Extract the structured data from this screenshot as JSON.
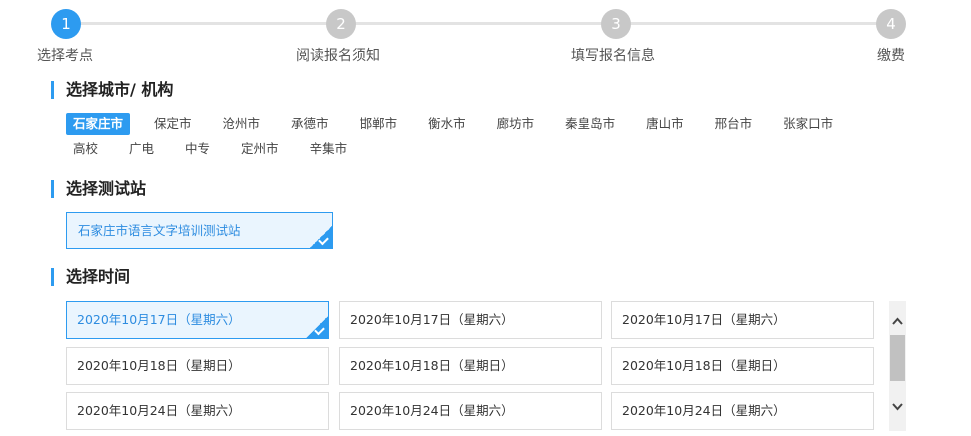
{
  "steps": [
    {
      "number": "1",
      "label": "选择考点"
    },
    {
      "number": "2",
      "label": "阅读报名须知"
    },
    {
      "number": "3",
      "label": "填写报名信息"
    },
    {
      "number": "4",
      "label": "缴费"
    }
  ],
  "city_section": {
    "title": "选择城市/ 机构",
    "cities": [
      "石家庄市",
      "保定市",
      "沧州市",
      "承德市",
      "邯郸市",
      "衡水市",
      "廊坊市",
      "秦皇岛市",
      "唐山市",
      "邢台市",
      "张家口市",
      "高校",
      "广电",
      "中专",
      "定州市",
      "辛集市"
    ],
    "selected": "石家庄市"
  },
  "station_section": {
    "title": "选择测试站",
    "station": "石家庄市语言文字培训测试站"
  },
  "time_section": {
    "title": "选择时间",
    "slots": [
      [
        "2020年10月17日（星期六）",
        "2020年10月17日（星期六）",
        "2020年10月17日（星期六）"
      ],
      [
        "2020年10月18日（星期日）",
        "2020年10月18日（星期日）",
        "2020年10月18日（星期日）"
      ],
      [
        "2020年10月24日（星期六）",
        "2020年10月24日（星期六）",
        "2020年10月24日（星期六）"
      ]
    ]
  },
  "colors": {
    "accent": "#2d9bf0",
    "inactive_step": "#c8c8c8",
    "selected_bg": "#eaf5fe"
  },
  "icons": {
    "scroll_up": "chevron-up-icon",
    "scroll_down": "chevron-down-icon",
    "check": "check-icon"
  }
}
